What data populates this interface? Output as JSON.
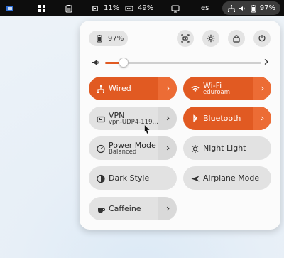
{
  "topbar": {
    "cpu_percent": "11%",
    "memory_percent": "49%",
    "keyboard_layout": "es",
    "battery_percent": "97%"
  },
  "quick_settings": {
    "battery_percent": "97%",
    "volume": {
      "level": 0.12
    },
    "tiles": {
      "wired": {
        "title": "Wired"
      },
      "wifi": {
        "title": "Wi-Fi",
        "subtitle": "eduroam"
      },
      "vpn": {
        "title": "VPN",
        "subtitle": "vpn-UDP4-119…"
      },
      "bluetooth": {
        "title": "Bluetooth"
      },
      "power_mode": {
        "title": "Power Mode",
        "subtitle": "Balanced"
      },
      "night_light": {
        "title": "Night Light"
      },
      "dark_style": {
        "title": "Dark Style"
      },
      "airplane_mode": {
        "title": "Airplane Mode"
      },
      "caffeine": {
        "title": "Caffeine"
      }
    }
  },
  "colors": {
    "accent": "#e15a22",
    "panel_bg": "#fbfbfb",
    "topbar_bg": "#0d0d0d"
  }
}
